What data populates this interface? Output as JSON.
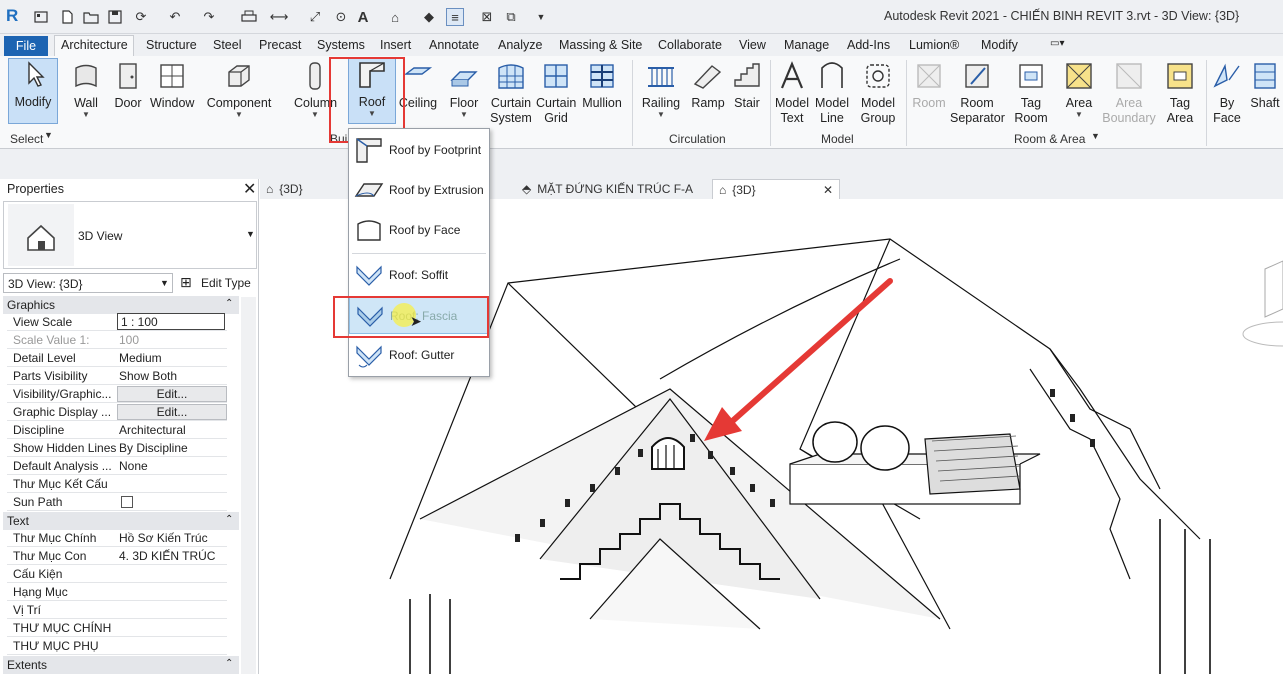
{
  "app": {
    "logo": "R",
    "title": "Autodesk Revit 2021 - CHIẾN BINH REVIT 3.rvt - 3D View: {3D}"
  },
  "qat": {
    "icons": [
      "open-icon",
      "new-icon",
      "save-icon",
      "sync-icon",
      "undo-icon",
      "redo-icon",
      "print-icon",
      "measure-icon",
      "dimension-icon",
      "tag-icon",
      "text-icon",
      "3d-view-icon",
      "section-icon",
      "thin-lines-icon",
      "close-hidden-icon",
      "switch-windows-icon",
      "customize-icon"
    ]
  },
  "tabs": [
    "File",
    "Architecture",
    "Structure",
    "Steel",
    "Precast",
    "Systems",
    "Insert",
    "Annotate",
    "Analyze",
    "Massing & Site",
    "Collaborate",
    "View",
    "Manage",
    "Add-Ins",
    "Lumion®",
    "Modify"
  ],
  "ribbon": {
    "tools": [
      {
        "label": "Modify",
        "icon": "cursor-icon"
      },
      {
        "label": "Wall",
        "icon": "wall-icon"
      },
      {
        "label": "Door",
        "icon": "door-icon"
      },
      {
        "label": "Window",
        "icon": "window-icon"
      },
      {
        "label": "Component",
        "icon": "component-icon"
      },
      {
        "label": "Column",
        "icon": "column-icon"
      },
      {
        "label": "Roof",
        "icon": "roof-icon"
      },
      {
        "label": "Ceiling",
        "icon": "ceiling-icon"
      },
      {
        "label": "Floor",
        "icon": "floor-icon"
      },
      {
        "label": "Curtain System",
        "icon": "curtain-system-icon"
      },
      {
        "label": "Curtain Grid",
        "icon": "curtain-grid-icon"
      },
      {
        "label": "Mullion",
        "icon": "mullion-icon"
      },
      {
        "label": "Railing",
        "icon": "railing-icon"
      },
      {
        "label": "Ramp",
        "icon": "ramp-icon"
      },
      {
        "label": "Stair",
        "icon": "stair-icon"
      },
      {
        "label": "Model Text",
        "icon": "model-text-icon"
      },
      {
        "label": "Model Line",
        "icon": "model-line-icon"
      },
      {
        "label": "Model Group",
        "icon": "model-group-icon"
      },
      {
        "label": "Room",
        "icon": "room-icon"
      },
      {
        "label": "Room Separator",
        "icon": "room-separator-icon"
      },
      {
        "label": "Tag Room",
        "icon": "tag-room-icon"
      },
      {
        "label": "Area",
        "icon": "area-icon"
      },
      {
        "label": "Area Boundary",
        "icon": "area-boundary-icon"
      },
      {
        "label": "Tag Area",
        "icon": "tag-area-icon"
      },
      {
        "label": "By Face",
        "icon": "by-face-icon"
      },
      {
        "label": "Shaft",
        "icon": "shaft-icon"
      }
    ],
    "groups": [
      "Select",
      "Bui",
      "Circulation",
      "Model",
      "Room & Area"
    ]
  },
  "roof_menu": {
    "items": [
      "Roof by Footprint",
      "Roof by Extrusion",
      "Roof by Face",
      "Roof: Soffit",
      "Roof: Fascia",
      "Roof: Gutter"
    ],
    "highlighted": "Roof: Fascia"
  },
  "properties": {
    "title": "Properties",
    "type_name": "3D View",
    "selector": "3D View: {3D}",
    "edit_type": "Edit Type",
    "sections": [
      {
        "name": "Graphics",
        "rows": [
          {
            "k": "View Scale",
            "v": "1 : 100"
          },
          {
            "k": "Scale Value    1:",
            "v": "100"
          },
          {
            "k": "Detail Level",
            "v": "Medium"
          },
          {
            "k": "Parts Visibility",
            "v": "Show Both"
          },
          {
            "k": "Visibility/Graphic...",
            "v": "Edit..."
          },
          {
            "k": "Graphic Display ...",
            "v": "Edit..."
          },
          {
            "k": "Discipline",
            "v": "Architectural"
          },
          {
            "k": "Show Hidden Lines",
            "v": "By Discipline"
          },
          {
            "k": "Default Analysis ...",
            "v": "None"
          },
          {
            "k": "Thư Mục Kết Cấu",
            "v": ""
          },
          {
            "k": "Sun Path",
            "v": ""
          }
        ]
      },
      {
        "name": "Text",
        "rows": [
          {
            "k": "Thư Mục Chính",
            "v": "Hồ Sơ Kiến Trúc"
          },
          {
            "k": "Thư Mục Con",
            "v": "4. 3D KIẾN TRÚC"
          },
          {
            "k": "Cấu Kiện",
            "v": ""
          },
          {
            "k": "Hạng Mục",
            "v": ""
          },
          {
            "k": "Vị Trí",
            "v": ""
          },
          {
            "k": "THƯ MỤC CHÍNH",
            "v": ""
          },
          {
            "k": "THƯ MỤC PHỤ",
            "v": ""
          }
        ]
      },
      {
        "name": "Extents",
        "rows": []
      }
    ]
  },
  "view_tabs": [
    "{3D}",
    "MẶT ĐỨNG KIẾN TRÚC F-A",
    "{3D}"
  ],
  "colors": {
    "accent": "#1d64b2",
    "highlight_red": "#e53935",
    "menu_hover": "#cfe6f7"
  }
}
